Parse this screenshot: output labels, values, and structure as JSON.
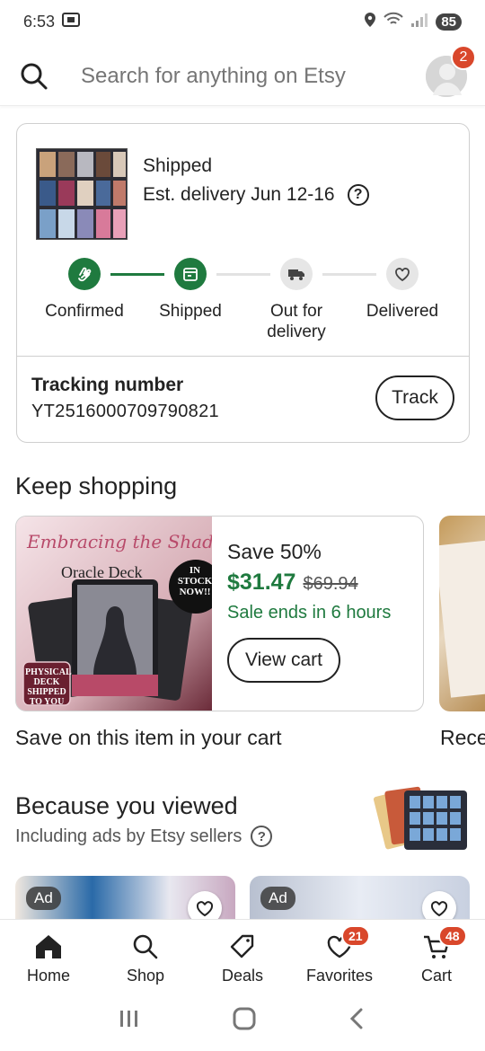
{
  "status_bar": {
    "time": "6:53",
    "battery": "85"
  },
  "search": {
    "placeholder": "Search for anything on Etsy",
    "notification_count": "2"
  },
  "order": {
    "status": "Shipped",
    "delivery": "Est. delivery Jun 12-16",
    "steps": [
      {
        "label": "Confirmed",
        "icon": "hand-icon",
        "done": true
      },
      {
        "label": "Shipped",
        "icon": "box-icon",
        "done": true
      },
      {
        "label": "Out for delivery",
        "icon": "truck-icon",
        "done": false
      },
      {
        "label": "Delivered",
        "icon": "heart-icon",
        "done": false
      }
    ],
    "tracking_title": "Tracking number",
    "tracking_number": "YT2516000709790821",
    "track_label": "Track"
  },
  "keep_shopping": {
    "title": "Keep shopping",
    "promo": {
      "image_title": "Embracing the Shadow",
      "image_subtitle": "Oracle Deck",
      "image_badge": "IN STOCK NOW!!",
      "image_corner": "PHYSICAL DECK SHIPPED TO YOU",
      "save": "Save 50%",
      "price": "$31.47",
      "original_price": "$69.94",
      "sale_ends": "Sale ends in 6 hours",
      "button": "View cart"
    },
    "caption": "Save on this item in your cart",
    "caption_next": "Rece"
  },
  "because_viewed": {
    "title": "Because you viewed",
    "subtitle": "Including ads by Etsy sellers",
    "listings": [
      {
        "badge": "Ad"
      },
      {
        "badge": "Ad"
      }
    ]
  },
  "bottom_nav": {
    "items": [
      {
        "label": "Home",
        "icon": "home-icon"
      },
      {
        "label": "Shop",
        "icon": "search-icon"
      },
      {
        "label": "Deals",
        "icon": "tag-icon"
      },
      {
        "label": "Favorites",
        "icon": "heart-icon",
        "badge": "21"
      },
      {
        "label": "Cart",
        "icon": "cart-icon",
        "badge": "48"
      }
    ]
  },
  "colors": {
    "accent_green": "#1f7a3f",
    "badge_red": "#d9472b"
  }
}
